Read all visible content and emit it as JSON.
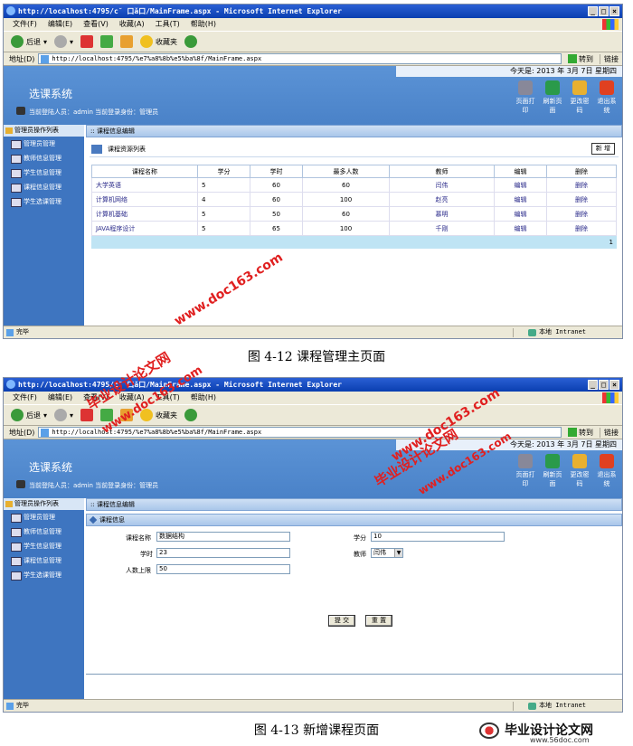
{
  "window1": {
    "title": "http://localhost:4795/c˘ 口ǎ口/MainFrame.aspx - Microsoft Internet Explorer",
    "menu": [
      "文件(F)",
      "编辑(E)",
      "查看(V)",
      "收藏(A)",
      "工具(T)",
      "帮助(H)"
    ],
    "toolbar": {
      "back": "后退",
      "favorites": "收藏夹"
    },
    "address_label": "地址(D)",
    "address": "http://localhost:4795/%e7%a8%8b%e5%ba%8f/MainFrame.aspx",
    "go": "转到",
    "links": "链接",
    "status": "完毕",
    "zone": "本地 Intranet"
  },
  "window2": {
    "title": "http://localhost:4795/c˘ 口ǎ口/MainFrame.aspx - Microsoft Internet Explorer",
    "address": "http://localhost:4795/%e7%a8%8b%e5%ba%8f/MainFrame.aspx"
  },
  "header": {
    "date": "今天是: 2013 年 3月 7日 星期四",
    "system": "选课系统",
    "user": "当前登陆人员：admin 当前登录身份：管理员",
    "actions": [
      "页面打印",
      "刷新页面",
      "更改密码",
      "退出系统"
    ]
  },
  "sidebar": {
    "title": "管理员操作列表",
    "items": [
      "管理员管理",
      "教师信息管理",
      "学生信息管理",
      "课程信息管理",
      "学生选课管理"
    ]
  },
  "page1": {
    "section": "课程信息编辑",
    "list_title": "课程资源列表",
    "add_button": "新 增",
    "headers": [
      "课程名称",
      "学分",
      "学时",
      "最多人数",
      "教师",
      "编辑",
      "删除"
    ],
    "rows": [
      [
        "大学英语",
        "5",
        "60",
        "60",
        "闫伟",
        "编辑",
        "删除"
      ],
      [
        "计算机网络",
        "4",
        "60",
        "100",
        "赵亮",
        "编辑",
        "删除"
      ],
      [
        "计算机基础",
        "5",
        "50",
        "60",
        "慕明",
        "编辑",
        "删除"
      ],
      [
        "JAVA程序设计",
        "5",
        "65",
        "100",
        "千刚",
        "编辑",
        "删除"
      ]
    ],
    "page": "1"
  },
  "caption1": "图 4-12 课程管理主页面",
  "page2": {
    "section": "课程信息编辑",
    "sub": "课程信息",
    "fields": {
      "name_label": "课程名称",
      "name_value": "数据结构",
      "credit_label": "学分",
      "credit_value": "10",
      "hours_label": "学时",
      "hours_value": "23",
      "teacher_label": "教师",
      "teacher_value": "闫伟",
      "limit_label": "人数上限",
      "limit_value": "50"
    },
    "submit": "提 交",
    "reset": "重 置"
  },
  "caption2": "图 4-13  新增课程页面",
  "watermarks": {
    "site": "www.doc163.com",
    "brand": "毕业设计论文网",
    "site2": "www.56doc.com"
  }
}
